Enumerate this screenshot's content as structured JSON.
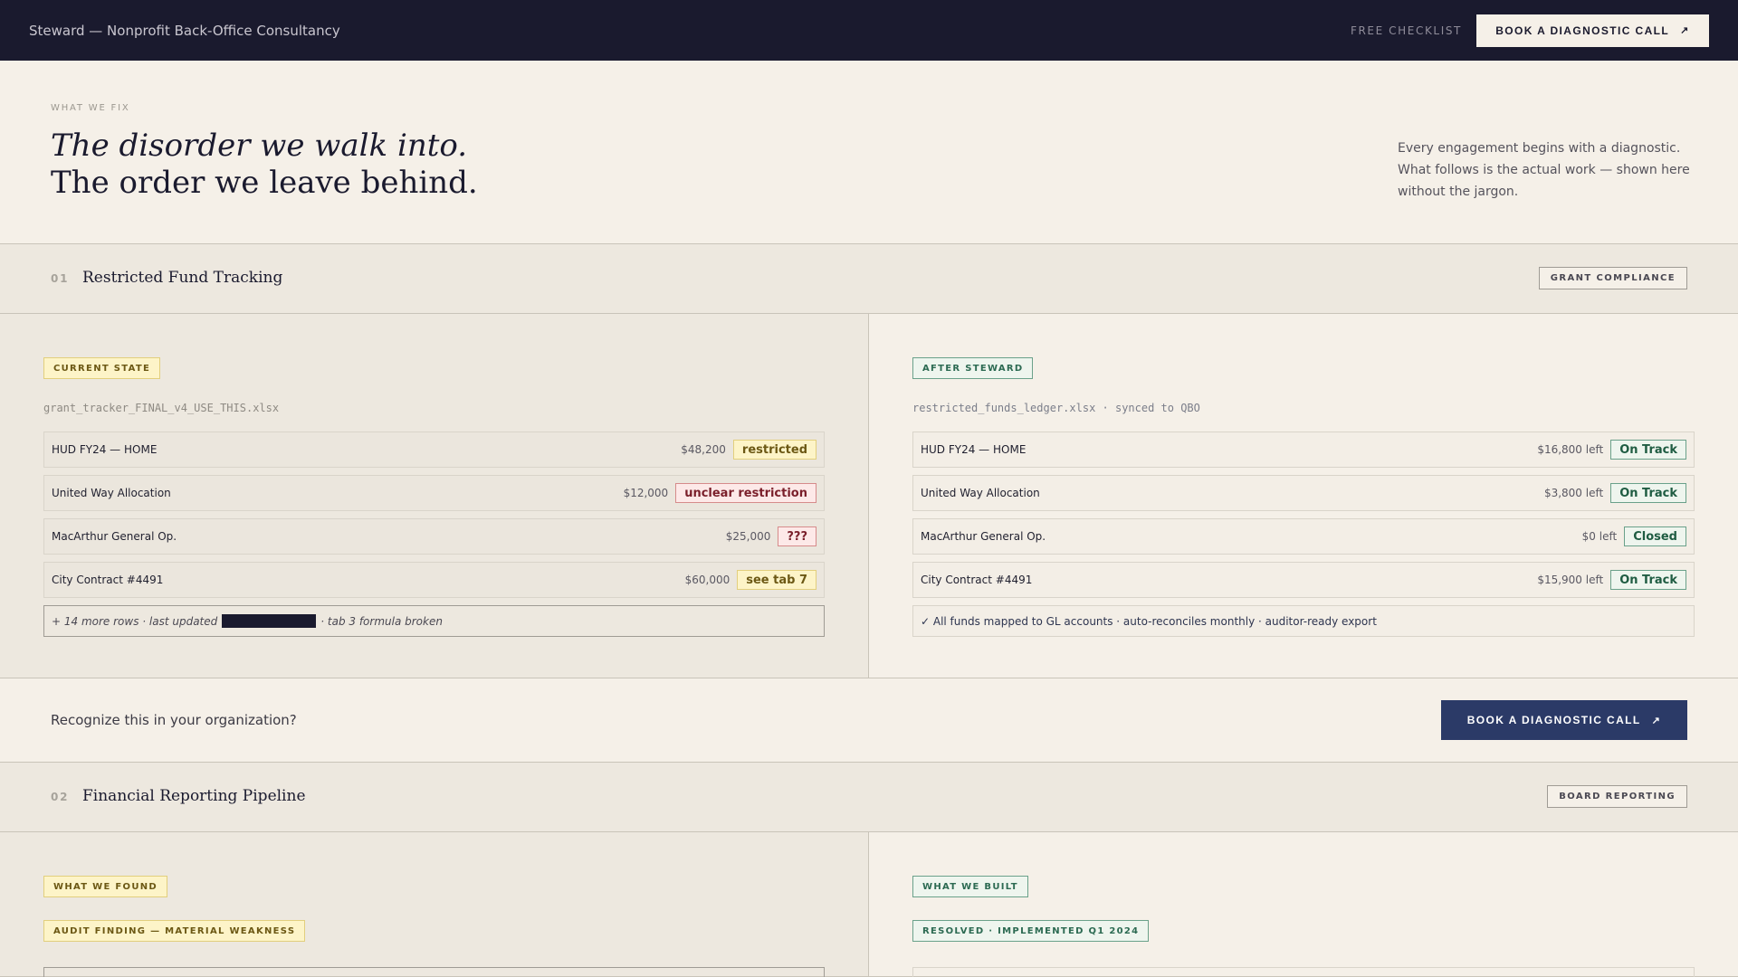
{
  "nav": {
    "brand": "Steward — Nonprofit Back-Office Consultancy",
    "checklist_label": "FREE CHECKLIST",
    "cta_label": "BOOK A DIAGNOSTIC CALL",
    "arrow": "↗"
  },
  "hero": {
    "eyebrow": "WHAT WE FIX",
    "headline_line1": "The disorder we walk into.",
    "headline_line2": "The order we leave behind.",
    "description": "Every engagement begins with a diagnostic. What follows is the actual work — shown here without the jargon."
  },
  "section1": {
    "number": "01",
    "title": "Restricted Fund Tracking",
    "tag": "GRANT COMPLIANCE",
    "left": {
      "pill": "CURRENT STATE",
      "filename": "grant_tracker_FINAL_v4_USE_THIS.xlsx",
      "rows": [
        {
          "name": "HUD FY24 — HOME",
          "amount": "$48,200",
          "badge": "restricted"
        },
        {
          "name": "United Way Allocation",
          "amount": "$12,000",
          "badge": "unclear restriction"
        },
        {
          "name": "MacArthur General Op.",
          "amount": "$25,000",
          "badge": "???"
        },
        {
          "name": "City Contract #4491",
          "amount": "$60,000",
          "badge": "see tab 7"
        }
      ],
      "note_before": "+ 14 more rows · last updated",
      "note_after": "· tab 3 formula broken"
    },
    "right": {
      "pill": "AFTER STEWARD",
      "filename": "restricted_funds_ledger.xlsx · synced to QBO",
      "rows": [
        {
          "name": "HUD FY24 — HOME",
          "amount": "$16,800 left",
          "badge": "On Track"
        },
        {
          "name": "United Way Allocation",
          "amount": "$3,800 left",
          "badge": "On Track"
        },
        {
          "name": "MacArthur General Op.",
          "amount": "$0 left",
          "badge": "Closed"
        },
        {
          "name": "City Contract #4491",
          "amount": "$15,900 left",
          "badge": "On Track"
        }
      ],
      "note": "✓ All funds mapped to GL accounts · auto-reconciles monthly · auditor-ready export"
    }
  },
  "cta": {
    "text": "Recognize this in your organization?",
    "button": "BOOK A DIAGNOSTIC CALL",
    "arrow": "↗"
  },
  "section2": {
    "number": "02",
    "title": "Financial Reporting Pipeline",
    "tag": "BOARD REPORTING",
    "left": {
      "pill": "WHAT WE FOUND",
      "pill2": "AUDIT FINDING — MATERIAL WEAKNESS"
    },
    "right": {
      "pill": "WHAT WE BUILT",
      "pill2": "RESOLVED · IMPLEMENTED Q1 2024"
    }
  },
  "colors": {
    "nav_bg": "#1a1a2e",
    "page_bg": "#f5f0e8",
    "panel_bg": "#ede8df",
    "accent_button": "#2b3a67",
    "warn": "#fdf4c8",
    "danger": "#fde9e8",
    "ok": "#eef5ee"
  }
}
